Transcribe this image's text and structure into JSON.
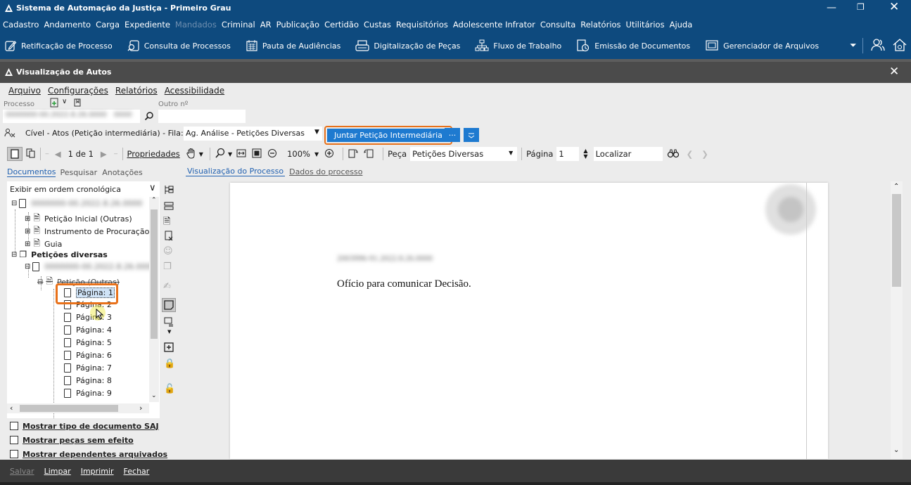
{
  "window": {
    "title": "Sistema de Automação da Justiça - Primeiro Grau"
  },
  "menu": [
    "Cadastro",
    "Andamento",
    "Carga",
    "Expediente",
    "Mandados",
    "Criminal",
    "AR",
    "Publicação",
    "Certidão",
    "Custas",
    "Requisitórios",
    "Adolescente Infrator",
    "Consulta",
    "Relatórios",
    "Utilitários",
    "Ajuda"
  ],
  "menu_disabled": "Mandados",
  "toolbar": [
    {
      "label": "Retificação de Processo",
      "icon": "pen-icon"
    },
    {
      "label": "Consulta de Processos",
      "icon": "search-doc-icon"
    },
    {
      "label": "Pauta de Audiências",
      "icon": "calendar-icon"
    },
    {
      "label": "Digitalização de Peças",
      "icon": "scanner-icon"
    },
    {
      "label": "Fluxo de Trabalho",
      "icon": "workflow-icon"
    },
    {
      "label": "Emissão de Documentos",
      "icon": "document-icon"
    },
    {
      "label": "Gerenciador de Arquivos",
      "icon": "folder-icon"
    }
  ],
  "subwindow": {
    "title": "Visualização de Autos"
  },
  "submenu": [
    "Arquivo",
    "Configurações",
    "Relatórios",
    "Acessibilidade"
  ],
  "form": {
    "processo_label": "Processo",
    "outro_label": "Outro nº",
    "processo_value": "0000000-00.2022.8.26.0000",
    "processo_suffix": "0000"
  },
  "fila": {
    "text": "Cível - Atos (Petição intermediária) - Fila:",
    "select": "Ag. Análise - Petições Diversas",
    "action_button": "Juntar Petição Intermediária",
    "more_button": "..."
  },
  "viewer_toolbar": {
    "page_counter": "1 de 1",
    "propriedades": "Propriedades",
    "zoom": "100%",
    "peca_label": "Peça",
    "peca_value": "Petições Diversas",
    "pagina_label": "Página",
    "pagina_value": "1",
    "localizar": "Localizar"
  },
  "left_tabs": [
    "Documentos",
    "Pesquisar",
    "Anotações"
  ],
  "order_select": "Exibir em ordem cronológica",
  "tree": {
    "root_blurred": "0000000-00.2022.8.26.0000",
    "docs": [
      "Petição Inicial (Outras)",
      "Instrumento de Procuração",
      "Guia"
    ],
    "group": "Petições diversas",
    "sub_blurred": "0000000-00.2022.8.26.0000",
    "peticao": "Petição (Outras)",
    "pages": [
      "Página: 1",
      "Página: 2",
      "Página: 3",
      "Página: 4",
      "Página: 5",
      "Página: 6",
      "Página: 7",
      "Página: 8",
      "Página: 9"
    ]
  },
  "checkboxes": [
    "Mostrar tipo de documento SAJ",
    "Mostrar peças sem efeito",
    "Mostrar dependentes arquivados"
  ],
  "viewer_tabs": [
    "Visualização do Processo",
    "Dados do processo"
  ],
  "document": {
    "blurred_number": "2003996-91.2022.8.26.0000",
    "body": "Ofício para comunicar Decisão."
  },
  "footer": [
    "Salvar",
    "Limpar",
    "Imprimir",
    "Fechar"
  ],
  "colors": {
    "titlebar": "#0e4a7e",
    "accent": "#1e7ad0",
    "highlight": "#e8711a"
  }
}
